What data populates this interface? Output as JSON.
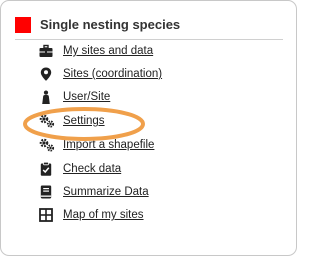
{
  "panel": {
    "title": "Single nesting species",
    "accent_color": "#ff0000"
  },
  "menu": {
    "items": [
      {
        "label": "My sites and data",
        "icon": "briefcase-icon"
      },
      {
        "label": "Sites (coordination)",
        "icon": "map-marker-icon"
      },
      {
        "label": "User/Site",
        "icon": "person-icon"
      },
      {
        "label": "Settings",
        "icon": "gears-icon"
      },
      {
        "label": "Import a shapefile",
        "icon": "gears-icon"
      },
      {
        "label": "Check data",
        "icon": "clipboard-check-icon"
      },
      {
        "label": "Summarize Data",
        "icon": "book-icon"
      },
      {
        "label": "Map of my sites",
        "icon": "grid-icon"
      }
    ]
  },
  "highlight": {
    "target": "Settings",
    "color": "#f0a04b"
  }
}
